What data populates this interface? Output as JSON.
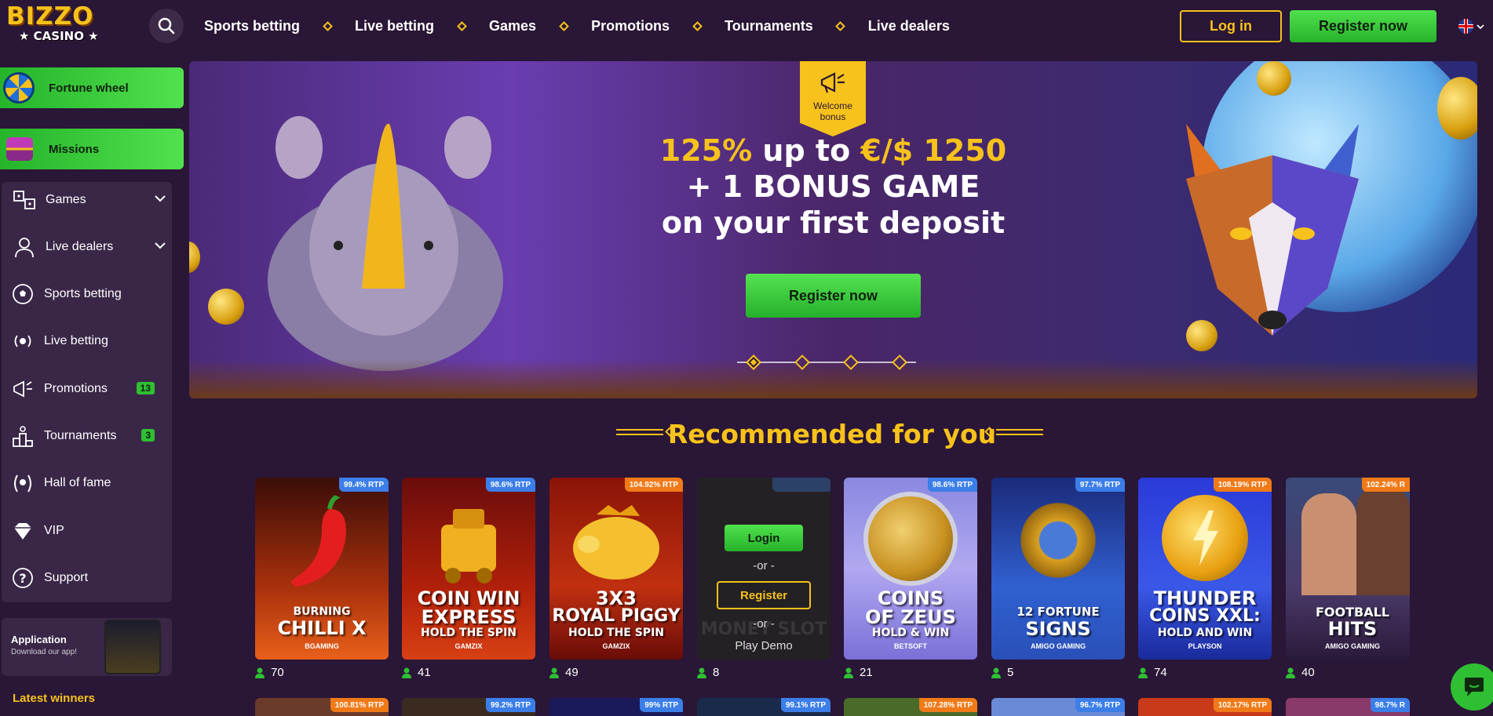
{
  "brand": {
    "name_top": "BIZZO",
    "name_bottom": "★ CASINO ★"
  },
  "nav": {
    "items": [
      "Sports betting",
      "Live betting",
      "Games",
      "Promotions",
      "Tournaments",
      "Live dealers"
    ],
    "login": "Log in",
    "register": "Register now"
  },
  "sidebar": {
    "promos": [
      {
        "label": "Fortune wheel",
        "icon": "fortune-wheel-icon"
      },
      {
        "label": "Missions",
        "icon": "treasure-chest-icon"
      }
    ],
    "items": [
      {
        "label": "Games",
        "icon": "games-icon",
        "expandable": true
      },
      {
        "label": "Live dealers",
        "icon": "dealer-icon",
        "expandable": true
      },
      {
        "label": "Sports betting",
        "icon": "soccer-ball-icon"
      },
      {
        "label": "Live betting",
        "icon": "live-icon"
      },
      {
        "label": "Promotions",
        "icon": "megaphone-icon",
        "badge": "13"
      },
      {
        "label": "Tournaments",
        "icon": "podium-icon",
        "badge": "3"
      },
      {
        "label": "Hall of fame",
        "icon": "laurel-icon"
      },
      {
        "label": "VIP",
        "icon": "diamond-icon"
      },
      {
        "label": "Support",
        "icon": "question-icon"
      }
    ],
    "app": {
      "title": "Application",
      "subtitle": "Download our app!"
    },
    "latest_winners": "Latest winners"
  },
  "banner": {
    "badge_line1": "Welcome",
    "badge_line2": "bonus",
    "line1_pct": "125%",
    "line1_mid": " up to ",
    "line1_amount": "€/$ 1250",
    "line2": "+ 1 BONUS GAME",
    "line3": "on your first deposit",
    "cta": "Register now",
    "slides": 4,
    "active_slide": 1
  },
  "recommended": {
    "title": "Recommended for you",
    "games": [
      {
        "title1": "BURNING",
        "title2": "CHILLI X",
        "provider": "BGAMING",
        "rtp": "99.4% RTP",
        "rtp_color": "blue",
        "players": "70"
      },
      {
        "title1": "COIN WIN",
        "title2": "EXPRESS",
        "title3": "HOLD THE SPIN",
        "provider": "GAMZIX",
        "rtp": "98.6% RTP",
        "rtp_color": "blue",
        "players": "41"
      },
      {
        "title1": "3X3",
        "title2": "ROYAL PIGGY",
        "title3": "HOLD THE SPIN",
        "provider": "GAMZIX",
        "rtp": "104.92% RTP",
        "rtp_color": "orange",
        "players": "49"
      },
      {
        "title1": "MONEY SLOT",
        "provider": "",
        "rtp": "",
        "rtp_color": "blue",
        "players": "8",
        "hover_login": "Login",
        "hover_or": "-or -",
        "hover_register": "Register",
        "hover_demo": "Play Demo"
      },
      {
        "title1": "COINS",
        "title2": "OF ZEUS",
        "title3": "HOLD & WIN",
        "provider": "BETSOFT",
        "rtp": "98.6% RTP",
        "rtp_color": "blue",
        "players": "21"
      },
      {
        "title1": "12 FORTUNE",
        "title2": "SIGNS",
        "provider": "AMIGO GAMING",
        "rtp": "97.7% RTP",
        "rtp_color": "blue",
        "players": "5"
      },
      {
        "title1": "THUNDER",
        "title2": "COINS XXL:",
        "title3": "HOLD AND WIN",
        "provider": "PLAYSON",
        "rtp": "108.19% RTP",
        "rtp_color": "orange",
        "players": "74"
      },
      {
        "title1": "FOOTBALL",
        "title2": "HITS",
        "provider": "AMIGO GAMING",
        "rtp": "102.24% R",
        "rtp_color": "orange",
        "players": "40"
      }
    ],
    "row2_rtp": [
      "100.81% RTP",
      "99.2% RTP",
      "99% RTP",
      "99.1% RTP",
      "107.28% RTP",
      "96.7% RTP",
      "102.17% RTP",
      "98.7% R"
    ]
  },
  "colors": {
    "bg": "#2a1636",
    "accent": "#f7c21b",
    "green": "#2fbf33",
    "panel": "#3a2748"
  }
}
